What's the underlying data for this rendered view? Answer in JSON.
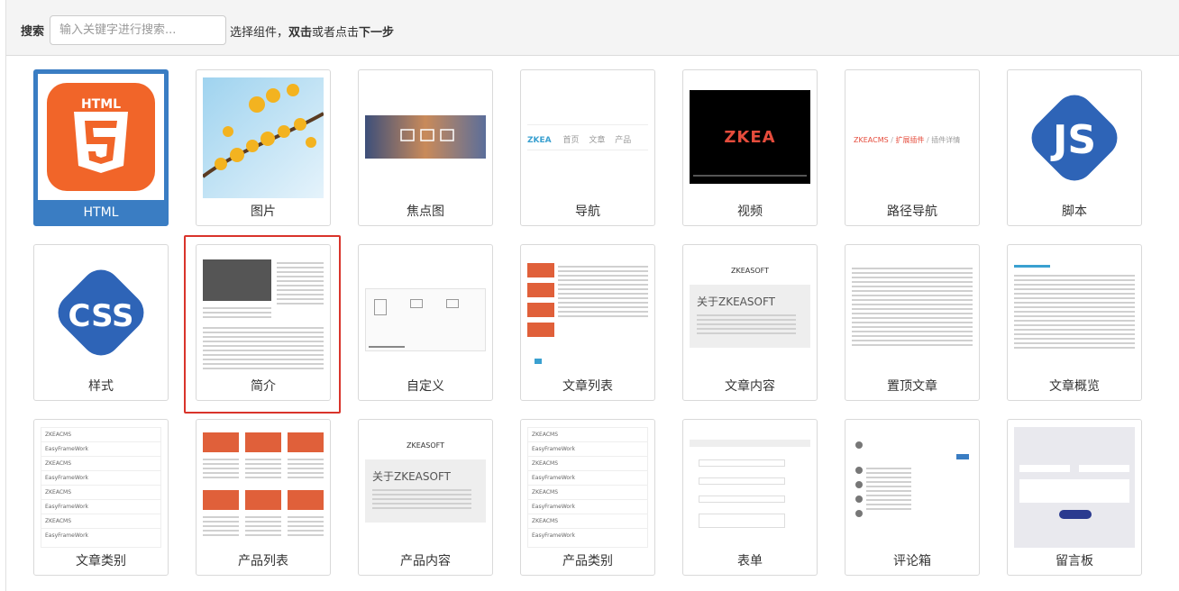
{
  "search": {
    "label": "搜索",
    "placeholder": "输入关键字进行搜索..."
  },
  "hint": {
    "part1": "选择组件，",
    "bold1": "双击",
    "part2": "或者点击",
    "bold2": "下一步"
  },
  "tiles": [
    "HTML",
    "图片",
    "焦点图",
    "导航",
    "视频",
    "路径导航",
    "脚本",
    "样式",
    "简介",
    "自定义",
    "文章列表",
    "文章内容",
    "置顶文章",
    "文章概览",
    "文章类别",
    "产品列表",
    "产品内容",
    "产品类别",
    "表单",
    "评论箱",
    "留言板"
  ],
  "thumbs": {
    "html_text": "HTML",
    "js_text": "JS",
    "css_text": "CSS",
    "nav_brand": "ZKEA",
    "nav_items": [
      "首页",
      "文章",
      "产品"
    ],
    "video_brand": "ZKEA",
    "breadcrumb": [
      "ZKEACMS",
      "/",
      "扩展插件",
      "/",
      "插件详情"
    ],
    "article_title": "ZKEASOFT",
    "article_heading": "关于ZKEASOFT",
    "category_items": [
      "ZKEACMS",
      "EasyFrameWork",
      "ZKEACMS",
      "EasyFrameWork",
      "ZKEACMS",
      "EasyFrameWork",
      "ZKEACMS",
      "EasyFrameWork"
    ],
    "product_category_items": [
      "ZKEACMS",
      "EasyFrameWork",
      "ZKEACMS",
      "EasyFrameWork",
      "ZKEACMS",
      "EasyFrameWork",
      "ZKEACMS",
      "EasyFrameWork"
    ]
  },
  "colors": {
    "selected": "#3a7dc3",
    "highlight": "#d9342b",
    "html5": "#f16529",
    "js": "#2e64b7",
    "css": "#2e64b7"
  }
}
